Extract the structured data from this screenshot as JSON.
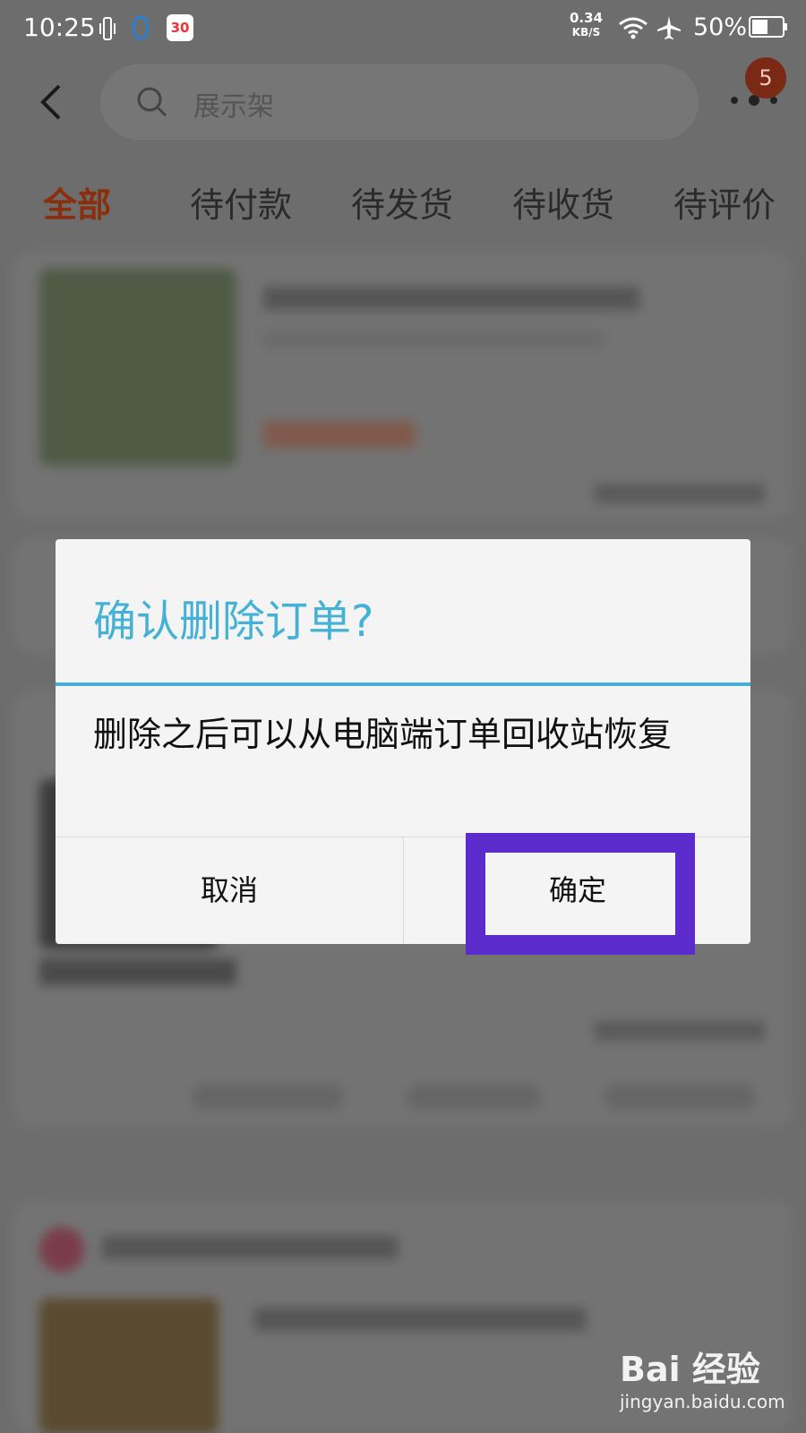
{
  "status_bar": {
    "time": "10:25",
    "calendar_badge": "30",
    "net_speed_value": "0.34",
    "net_speed_unit": "KB/S",
    "battery_percent": "50%"
  },
  "header": {
    "search_placeholder": "展示架",
    "cart_badge": "5"
  },
  "tabs": [
    {
      "label": "全部",
      "active": true
    },
    {
      "label": "待付款"
    },
    {
      "label": "待发货"
    },
    {
      "label": "待收货"
    },
    {
      "label": "待评价"
    }
  ],
  "dialog": {
    "title": "确认删除订单?",
    "message": "删除之后可以从电脑端订单回收站恢复",
    "cancel_label": "取消",
    "confirm_label": "确定",
    "accent_color": "#45b2d5"
  },
  "highlight_color": "#5b2bcc",
  "watermark": {
    "brand": "Bai 经验",
    "url": "jingyan.baidu.com"
  }
}
